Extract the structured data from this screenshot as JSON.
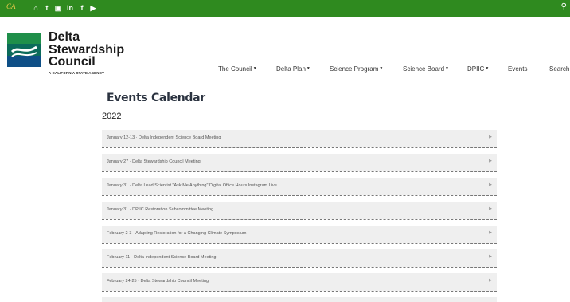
{
  "topbar": {
    "ca_logo": "CA",
    "social": [
      "⌂",
      "t",
      "▣",
      "in",
      "f",
      "▶"
    ],
    "search_icon": "⚲"
  },
  "logo": {
    "lines": [
      "Delta",
      "Stewardship",
      "Council"
    ],
    "subtitle": "A CALIFORNIA STATE AGENCY"
  },
  "nav": {
    "items": [
      {
        "label": "The Council",
        "caret": true
      },
      {
        "label": "Delta Plan",
        "caret": true
      },
      {
        "label": "Science Program",
        "caret": true
      },
      {
        "label": "Science Board",
        "caret": true
      },
      {
        "label": "DPIIC",
        "caret": true
      },
      {
        "label": "Events",
        "caret": false
      },
      {
        "label": "Search",
        "caret": false
      }
    ]
  },
  "page": {
    "title": "Events Calendar",
    "year": "2022"
  },
  "events": [
    "January 12-13 · Delta Independent Science Board Meeting",
    "January 27 · Delta Stewardship Council Meeting",
    "January 31 · Delta Lead Scientist \"Ask Me Anything\" Digital Office Hours Instagram Live",
    "January 31 · DPIIC Restoration Subcommittee Meeting",
    "February 2-3 · Adapting Restoration for a Changing Climate Symposium",
    "February 11 · Delta Independent Science Board Meeting",
    "February 24-25 · Delta Stewardship Council Meeting"
  ],
  "colors": {
    "topbar": "#2f8a1f",
    "row_bg": "#efefef"
  }
}
